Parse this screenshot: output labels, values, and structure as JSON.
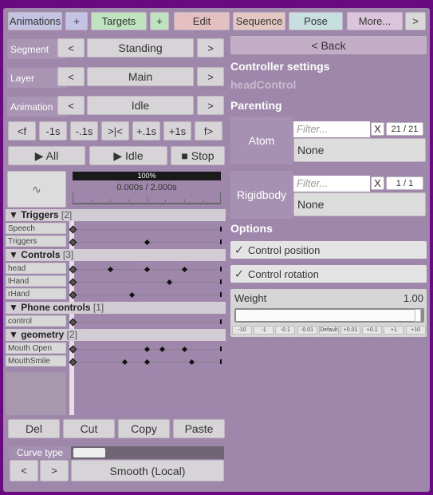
{
  "tabs": [
    {
      "label": "Animations",
      "color": "#c4c3e4"
    },
    {
      "label": "+",
      "color": "#c4c3e4"
    },
    {
      "label": "Targets",
      "color": "#bfe2bf"
    },
    {
      "label": "+",
      "color": "#bfe2bf"
    },
    {
      "label": "Edit",
      "color": "#e4c0c2"
    },
    {
      "label": "Sequence",
      "color": "#e4c6c2"
    },
    {
      "label": "Pose",
      "color": "#c7dfdf"
    },
    {
      "label": "More...",
      "color": "#dcc4dc"
    },
    {
      "label": ">",
      "color": "#d8d8d8"
    }
  ],
  "selectors": [
    {
      "label": "Segment",
      "value": "Standing"
    },
    {
      "label": "Layer",
      "value": "Main"
    },
    {
      "label": "Animation",
      "value": "Idle"
    }
  ],
  "prev": "<",
  "next": ">",
  "step_buttons": [
    "<f",
    "-1s",
    "-.1s",
    ">|<",
    "+.1s",
    "+1s",
    "f>"
  ],
  "play": {
    "all": "▶ All",
    "idle": "▶ Idle",
    "stop": "■ Stop"
  },
  "timeline": {
    "zoom": "100%",
    "time": "0.000s / 2.000s",
    "current": 0,
    "duration": 2.0
  },
  "groups": [
    {
      "name": "▼ Triggers",
      "count": "[2]",
      "tracks": [
        {
          "name": "Speech",
          "keys": [
            0,
            2
          ]
        },
        {
          "name": "Triggers",
          "keys": [
            0,
            1.0,
            2
          ]
        }
      ]
    },
    {
      "name": "▼ Controls",
      "count": "[3]",
      "tracks": [
        {
          "name": "head",
          "keys": [
            0,
            0.5,
            1.0,
            1.5,
            2
          ]
        },
        {
          "name": "lHand",
          "keys": [
            0,
            1.3,
            2
          ]
        },
        {
          "name": "rHand",
          "keys": [
            0,
            0.8,
            2
          ]
        }
      ]
    },
    {
      "name": "▼ Phone controls",
      "count": "[1]",
      "tracks": [
        {
          "name": "control",
          "keys": [
            0,
            2
          ]
        }
      ]
    },
    {
      "name": "▼ geometry",
      "count": "[2]",
      "tracks": [
        {
          "name": "Mouth Open",
          "keys": [
            0,
            1.0,
            1.2,
            1.5,
            2
          ]
        },
        {
          "name": "MouthSmile",
          "keys": [
            0,
            0.7,
            1.0,
            1.6,
            2
          ]
        }
      ]
    }
  ],
  "edit": [
    "Del",
    "Cut",
    "Copy",
    "Paste"
  ],
  "curve": {
    "label": "Curve type",
    "value": "Smooth (Local)"
  },
  "right": {
    "back": "< Back",
    "title": "Controller settings",
    "controller": "headControl",
    "parenting": "Parenting",
    "atom": {
      "label": "Atom",
      "placeholder": "Filter...",
      "clear": "X",
      "count": "21 / 21",
      "value": "None"
    },
    "rigidbody": {
      "label": "Rigidbody",
      "placeholder": "Filter...",
      "clear": "X",
      "count": "1 / 1",
      "value": "None"
    },
    "options": "Options",
    "control_position": "Control position",
    "control_rotation": "Control rotation",
    "weight": {
      "label": "Weight",
      "value": "1.00",
      "fraction": 1.0,
      "steps": [
        "-10",
        "-1",
        "-0.1",
        "-0.01",
        "Default",
        "+0.01",
        "+0.1",
        "+1",
        "+10"
      ]
    }
  }
}
